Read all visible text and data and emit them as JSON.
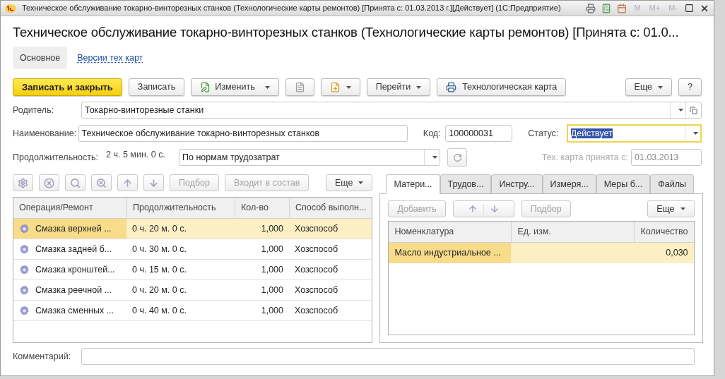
{
  "window": {
    "title": "Техническое обслуживание токарно-винторезных станков (Технологические карты ремонтов) [Принята с: 01.03.2013 г.][Действует]  (1С:Предприятие)",
    "memory_buttons": [
      "M",
      "M+",
      "M-"
    ]
  },
  "heading": "Техническое обслуживание токарно-винторезных станков (Технологические карты ремонтов) [Принята с: 01.0...",
  "nav": [
    {
      "label": "Основное",
      "selected": true
    },
    {
      "label": "Версии тех карт",
      "selected": false
    }
  ],
  "toolbar": [
    {
      "kind": "primary",
      "label": "Записать и закрыть"
    },
    {
      "kind": "button",
      "label": "Записать"
    },
    {
      "kind": "edit-menu",
      "label": "Изменить"
    },
    {
      "kind": "icon"
    },
    {
      "kind": "icon-menu"
    },
    {
      "kind": "menu",
      "label": "Перейти"
    },
    {
      "kind": "print",
      "label": "Технологическая карта"
    },
    {
      "kind": "spacer"
    },
    {
      "kind": "menu",
      "label": "Еще"
    },
    {
      "kind": "button",
      "label": "?"
    }
  ],
  "parent": {
    "label": "Родитель:",
    "value": "Токарно-винторезные станки"
  },
  "name": {
    "label": "Наименование:",
    "value": "Техническое обслуживание токарно-винторезных станков"
  },
  "code": {
    "label": "Код:",
    "value": "100000031"
  },
  "status": {
    "label": "Статус:",
    "value": "Действует",
    "focused": true
  },
  "duration": {
    "label": "Продолжительность:",
    "value": "2 ч. 5 мин. 0 с.",
    "mode": "По нормам трудозатрат"
  },
  "accepted": {
    "label": "Тех. карта принята с:",
    "value": "01.03.2013",
    "disabled": true
  },
  "ops_toolbar": [
    {
      "kind": "icon",
      "disabled": true
    },
    {
      "kind": "icon",
      "disabled": true
    },
    {
      "kind": "icon",
      "disabled": true
    },
    {
      "kind": "icon",
      "disabled": true
    },
    {
      "kind": "icon",
      "disabled": true
    },
    {
      "kind": "icon",
      "disabled": true
    },
    {
      "kind": "text",
      "label": "Подбор",
      "disabled": true
    },
    {
      "kind": "text",
      "label": "Входит в состав",
      "disabled": true
    },
    {
      "kind": "menu",
      "label": "Еще",
      "disabled": false
    }
  ],
  "operations": {
    "columns": [
      "Операция/Ремонт",
      "Продолжительность",
      "Кол-во",
      "Способ выполн..."
    ],
    "rows": [
      {
        "name": "Смазка верхней ...",
        "duration": "0 ч. 20 м. 0 с.",
        "qty": "1,000",
        "method": "Хозспособ",
        "selected": true
      },
      {
        "name": "Смазка задней б...",
        "duration": "0 ч. 30 м. 0 с.",
        "qty": "1,000",
        "method": "Хозспособ",
        "selected": false
      },
      {
        "name": "Смазка кронштей...",
        "duration": "0 ч. 15 м. 0 с.",
        "qty": "1,000",
        "method": "Хозспособ",
        "selected": false
      },
      {
        "name": "Смазка реечной ...",
        "duration": "0 ч. 20 м. 0 с.",
        "qty": "1,000",
        "method": "Хозспособ",
        "selected": false
      },
      {
        "name": "Смазка сменных ...",
        "duration": "0 ч. 40 м. 0 с.",
        "qty": "1,000",
        "method": "Хозспособ",
        "selected": false
      }
    ]
  },
  "tabs": [
    {
      "label": "Матери...",
      "selected": true
    },
    {
      "label": "Трудов...",
      "selected": false
    },
    {
      "label": "Инстру...",
      "selected": false
    },
    {
      "label": "Измеря...",
      "selected": false
    },
    {
      "label": "Меры б...",
      "selected": false
    },
    {
      "label": "Файлы",
      "selected": false
    }
  ],
  "materials_toolbar": [
    {
      "kind": "text",
      "label": "Добавить",
      "disabled": true
    },
    {
      "kind": "arrows",
      "disabled": true
    },
    {
      "kind": "text",
      "label": "Подбор",
      "disabled": true
    },
    {
      "kind": "spacer"
    },
    {
      "kind": "menu",
      "label": "Еще",
      "disabled": false
    }
  ],
  "materials": {
    "columns": [
      "Номенклатура",
      "Ед. изм.",
      "Количество"
    ],
    "rows": [
      {
        "name": "Масло индустриальное ...",
        "unit": "",
        "qty": "0,030",
        "selected": true
      }
    ]
  },
  "comment": {
    "label": "Комментарий:"
  }
}
